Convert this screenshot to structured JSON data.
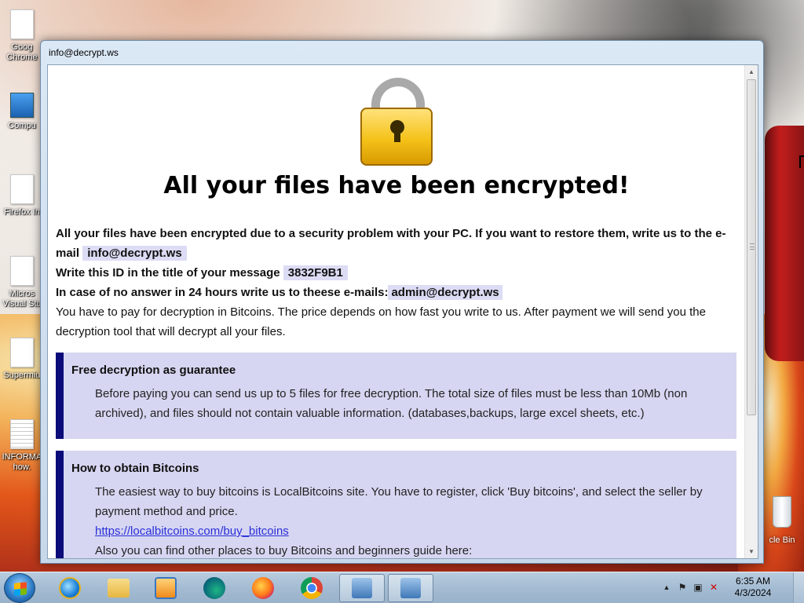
{
  "desktop": {
    "icons": [
      {
        "label": "Goog Chrome"
      },
      {
        "label": "Compu"
      },
      {
        "label": "Firefox In"
      },
      {
        "label": "Micros Visual Stu"
      },
      {
        "label": "Supermiu"
      },
      {
        "label": "INFORMA how."
      }
    ],
    "recycle_bin_label": "cle Bin"
  },
  "window": {
    "title": "info@decrypt.ws",
    "headline": "All your files have been encrypted!",
    "intro_text": "All your files have been encrypted due to a security problem with your PC. If you want to restore them, write us to the e-mail",
    "email": "info@decrypt.ws",
    "id_text": "Write this ID in the title of your message",
    "id_value": "3832F9B1",
    "no_answer_text": "In case of no answer in 24 hours write us to theese e-mails:",
    "alt_email": "admin@decrypt.ws",
    "pay_text": "You have to pay for decryption in Bitcoins. The price depends on how fast you write to us. After payment we will send you the decryption tool that will decrypt all your files.",
    "sections": [
      {
        "title": "Free decryption as guarantee",
        "text": "Before paying you can send us up to 5 files for free decryption. The total size of files must be less than 10Mb (non archived), and files should not contain valuable information. (databases,backups, large excel sheets, etc.)"
      },
      {
        "title": "How to obtain Bitcoins",
        "text": "The easiest way to buy bitcoins is LocalBitcoins site. You have to register, click 'Buy bitcoins', and select the seller by payment method and price.",
        "link": "https://localbitcoins.com/buy_bitcoins",
        "text2": "Also you can find other places to buy Bitcoins and beginners guide here:"
      }
    ]
  },
  "taskbar": {
    "apps": [
      "Internet Explorer",
      "Windows Explorer",
      "Media Player",
      "Edge",
      "Firefox",
      "Chrome",
      "Program 1",
      "Program 2"
    ],
    "clock_time": "6:35 AM",
    "clock_date": "4/3/2024"
  },
  "colors": {
    "accent_bar": "#0b0b7a",
    "box_bg": "#d6d6f2",
    "link": "#2b2fd8"
  }
}
